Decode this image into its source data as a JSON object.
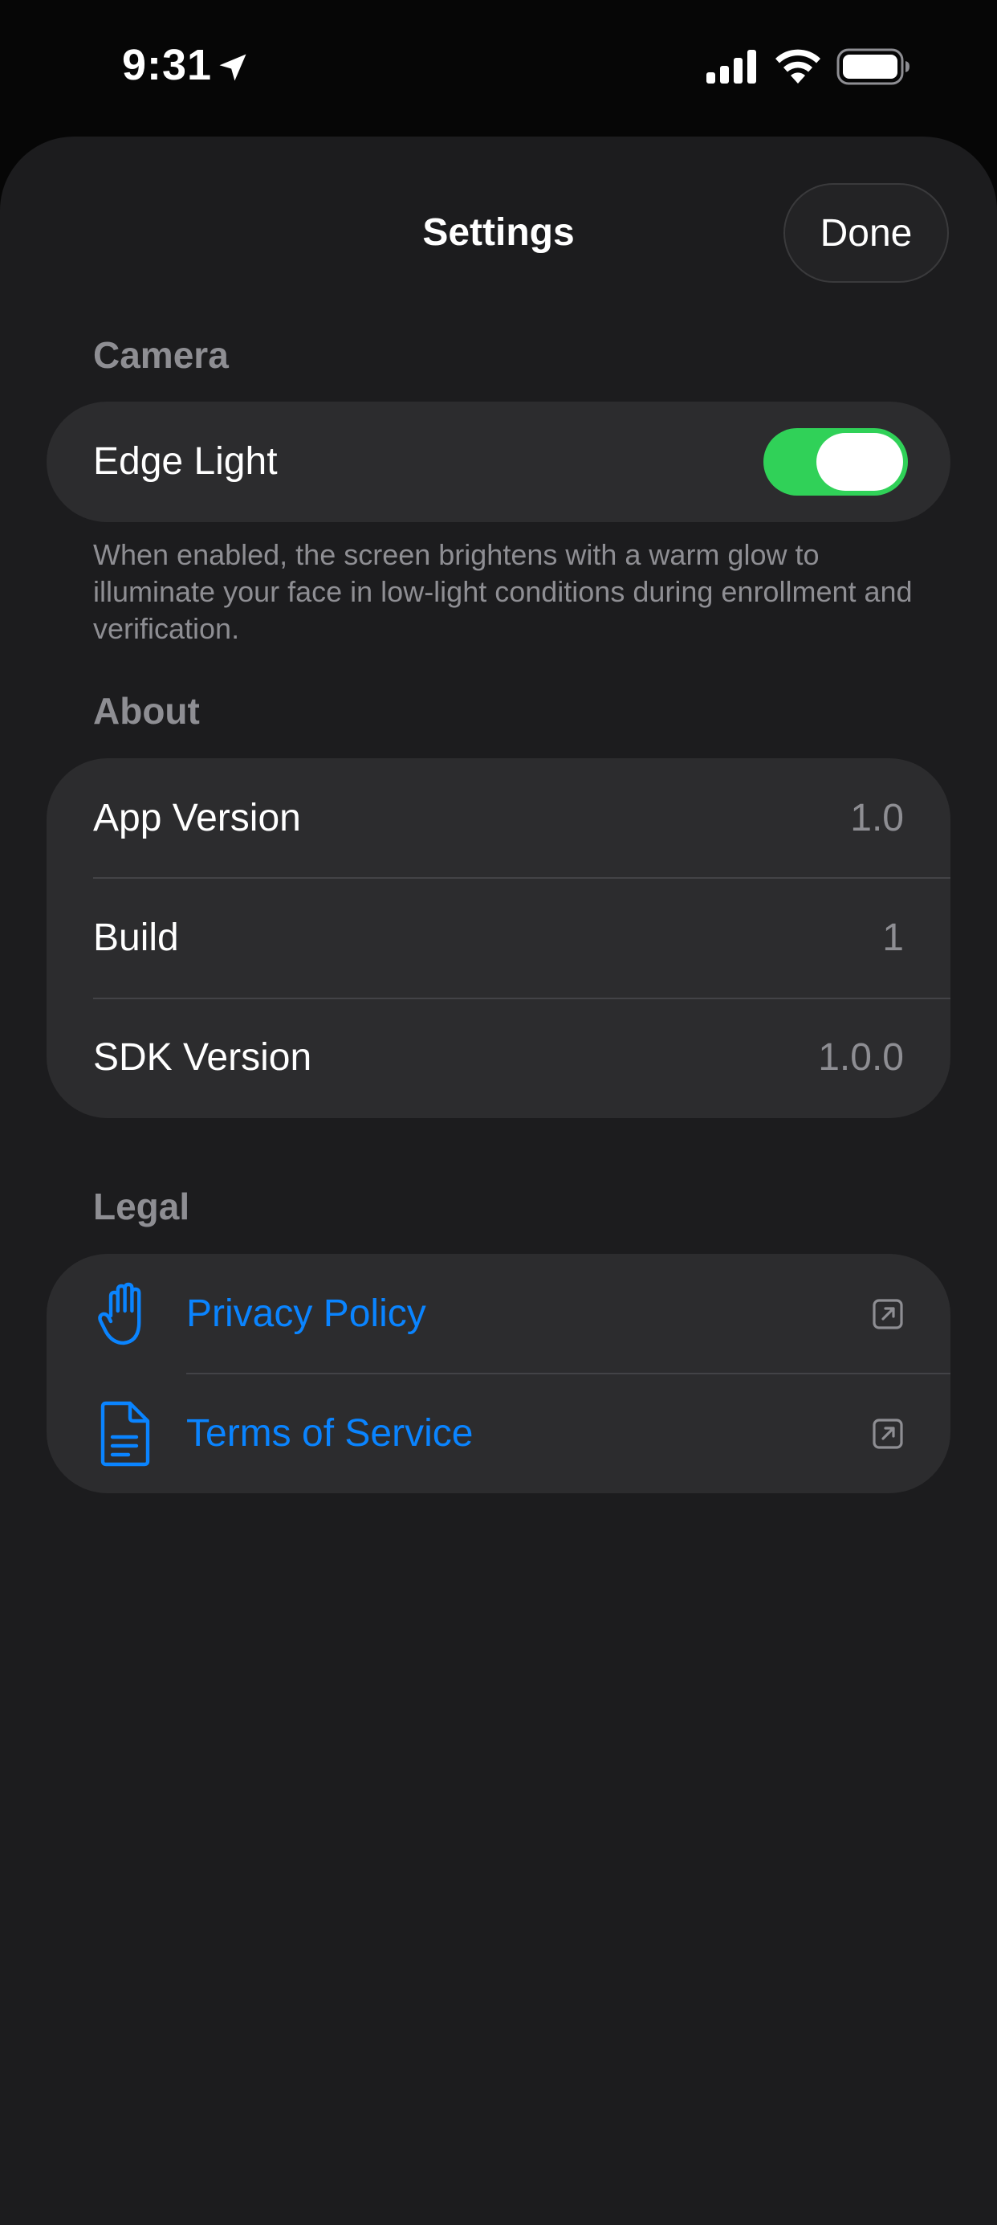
{
  "status_bar": {
    "time": "9:31",
    "icons": [
      "location-arrow-icon",
      "cellular-signal-icon",
      "wifi-icon",
      "battery-icon"
    ]
  },
  "nav": {
    "title": "Settings",
    "done_label": "Done"
  },
  "camera": {
    "header": "Camera",
    "edge_light_label": "Edge Light",
    "edge_light_on": true,
    "footer": "When enabled, the screen brightens with a warm glow to illuminate your face in low-light conditions during enrollment and verification."
  },
  "about": {
    "header": "About",
    "rows": [
      {
        "label": "App Version",
        "value": "1.0"
      },
      {
        "label": "Build",
        "value": "1"
      },
      {
        "label": "SDK Version",
        "value": "1.0.0"
      }
    ]
  },
  "legal": {
    "header": "Legal",
    "rows": [
      {
        "label": "Privacy Policy",
        "icon": "raised-hand-icon"
      },
      {
        "label": "Terms of Service",
        "icon": "document-icon"
      }
    ]
  },
  "colors": {
    "accent": "#0a84ff",
    "toggle_on": "#30d158",
    "background": "#1c1c1e",
    "cell": "#2c2c2e",
    "secondary_text": "#8e8e93"
  }
}
